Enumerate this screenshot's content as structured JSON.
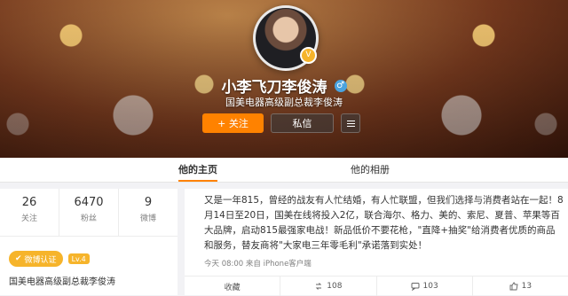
{
  "profile": {
    "name": "小李飞刀李俊涛",
    "subtitle": "国美电器高级副总裁李俊涛",
    "follow_label": "+ 关注",
    "message_label": "私信"
  },
  "tabs": [
    {
      "label": "他的主页"
    },
    {
      "label": "他的相册"
    }
  ],
  "stats": [
    {
      "value": "26",
      "label": "关注"
    },
    {
      "value": "6470",
      "label": "粉丝"
    },
    {
      "value": "9",
      "label": "微博"
    }
  ],
  "badges": {
    "verify_label": "微博认证",
    "level_label": "Lv.4"
  },
  "sidebar_desc": "国美电器高级副总裁李俊涛",
  "post": {
    "text": "又是一年815，曾经的战友有人忙结婚，有人忙联盟，但我们选择与消费者站在一起！8月14日至20日，国美在线将投入2亿，联合海尔、格力、美的、索尼、夏普、苹果等百大品牌，启动815最强家电战！新品低价不要花枪，\"直降+抽奖\"给消费者优质的商品和服务，替友商将\"大家电三年零毛利\"承诺落到实处！",
    "meta": "今天 08:00 来自 iPhone客户端",
    "actions": {
      "favorite": "收藏",
      "repost": "108",
      "comment": "103",
      "like": "13"
    }
  }
}
